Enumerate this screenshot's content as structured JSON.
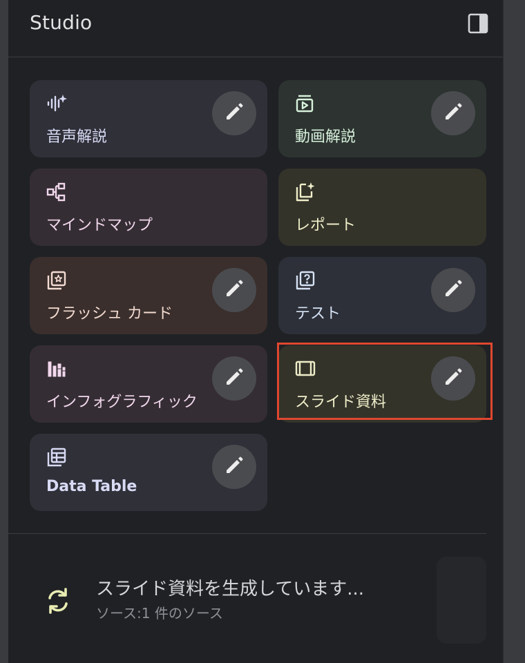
{
  "header": {
    "title": "Studio",
    "toggle_icon": "side-panel-icon"
  },
  "cards": [
    {
      "label": "音声解説",
      "icon": "audio-sparkle-icon",
      "bg": "#2f3038",
      "fg": "#d9dbf5",
      "has_edit": true
    },
    {
      "label": "動画解説",
      "icon": "video-play-icon",
      "bg": "#2c3330",
      "fg": "#d8f2dc",
      "has_edit": true
    },
    {
      "label": "マインドマップ",
      "icon": "mind-map-icon",
      "bg": "#352d34",
      "fg": "#f1d7ec",
      "has_edit": false
    },
    {
      "label": "レポート",
      "icon": "report-sparkle-icon",
      "bg": "#33332a",
      "fg": "#efeec9",
      "has_edit": false
    },
    {
      "label": "フラッシュ カード",
      "icon": "flashcards-icon",
      "bg": "#3a2f2c",
      "fg": "#f4dcd3",
      "has_edit": true
    },
    {
      "label": "テスト",
      "icon": "quiz-icon",
      "bg": "#2d3038",
      "fg": "#d6e2f5",
      "has_edit": true
    },
    {
      "label": "インフォグラフィック",
      "icon": "infographic-icon",
      "bg": "#352d34",
      "fg": "#f1d7ec",
      "has_edit": true
    },
    {
      "label": "スライド資料",
      "icon": "slides-icon",
      "bg": "#33332a",
      "fg": "#efeec9",
      "has_edit": true
    },
    {
      "label": "Data Table",
      "icon": "table-icon",
      "bg": "#2f3038",
      "fg": "#d9dbf5",
      "has_edit": true
    }
  ],
  "status": {
    "title": "スライド資料を生成しています...",
    "subtitle": "ソース:1 件のソース",
    "icon": "sync-icon"
  },
  "highlight_color": "#e0472f"
}
